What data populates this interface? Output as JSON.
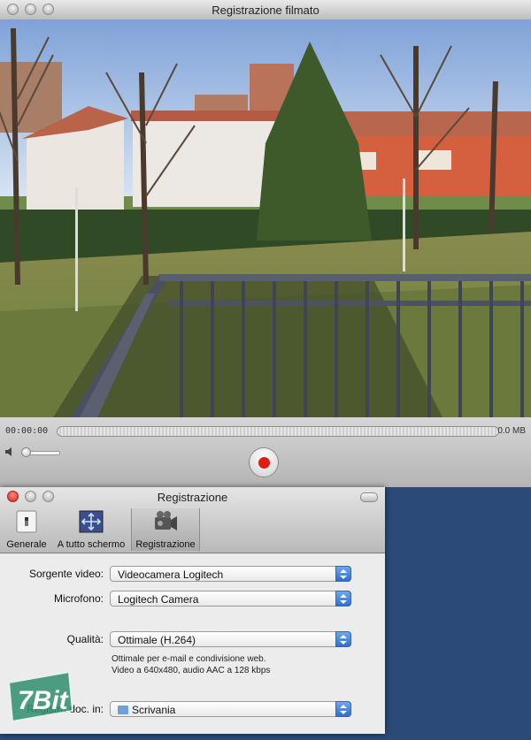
{
  "recorder": {
    "title": "Registrazione filmato",
    "time": "00:00:00",
    "size": "0.0 MB"
  },
  "prefs": {
    "title": "Registrazione",
    "toolbar": [
      {
        "label": "Generale",
        "icon": "switch-icon"
      },
      {
        "label": "A tutto schermo",
        "icon": "fullscreen-arrows-icon"
      },
      {
        "label": "Registrazione",
        "icon": "video-camera-icon"
      }
    ],
    "video_source_label": "Sorgente video:",
    "video_source_value": "Videocamera Logitech",
    "microphone_label": "Microfono:",
    "microphone_value": "Logitech Camera",
    "quality_label": "Qualità:",
    "quality_value": "Ottimale (H.264)",
    "quality_desc_1": "Ottimale per e-mail e condivisione web.",
    "quality_desc_2": "Video a 640x480, audio AAC a 128 kbps",
    "save_label": "Registra doc. in:",
    "save_value": "Scrivania"
  },
  "watermark": {
    "text": "7Bit"
  },
  "colors": {
    "record_red": "#e41b12",
    "popup_blue": "#2b6fd0",
    "desktop": "#2b4a78"
  }
}
